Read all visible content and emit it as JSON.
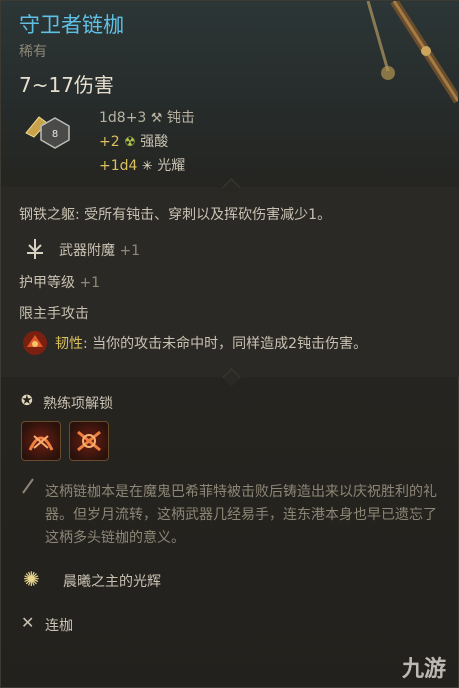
{
  "item": {
    "name": "守卫者链枷",
    "rarity": "稀有",
    "damage_range": "7~17伤害",
    "die_value": "8"
  },
  "damage": {
    "base": "1d8+3",
    "base_type": "钝击",
    "acid_bonus": "+2",
    "acid_type": "强酸",
    "radiant_bonus": "+1d4",
    "radiant_type": "光耀"
  },
  "properties": {
    "passive": "钢铁之躯: 受所有钝击、穿刺以及挥砍伤害减少1。",
    "enchant_label": "武器附魔",
    "enchant_value": "+1",
    "ac_label": "护甲等级",
    "ac_value": "+1",
    "main_hand": "限主手攻击",
    "toughness_label": "韧性",
    "toughness_text": ": 当你的攻击未命中时，同样造成2钝击伤害。"
  },
  "proficiency": {
    "label": "熟练项解锁"
  },
  "lore": "这柄链枷本是在魔鬼巴希菲特被击败后铸造出来以庆祝胜利的礼器。但岁月流转，这柄武器几经易手，连东港本身也早已遗忘了这柄多头链枷的意义。",
  "spell": "晨曦之主的光辉",
  "weapon_type": "连枷",
  "watermark": "九游",
  "colors": {
    "title": "#5fc0e6",
    "bonus": "#d9c15e",
    "acid": "#b5c94a",
    "text": "#c9c2b3",
    "dim": "#8f897a"
  }
}
